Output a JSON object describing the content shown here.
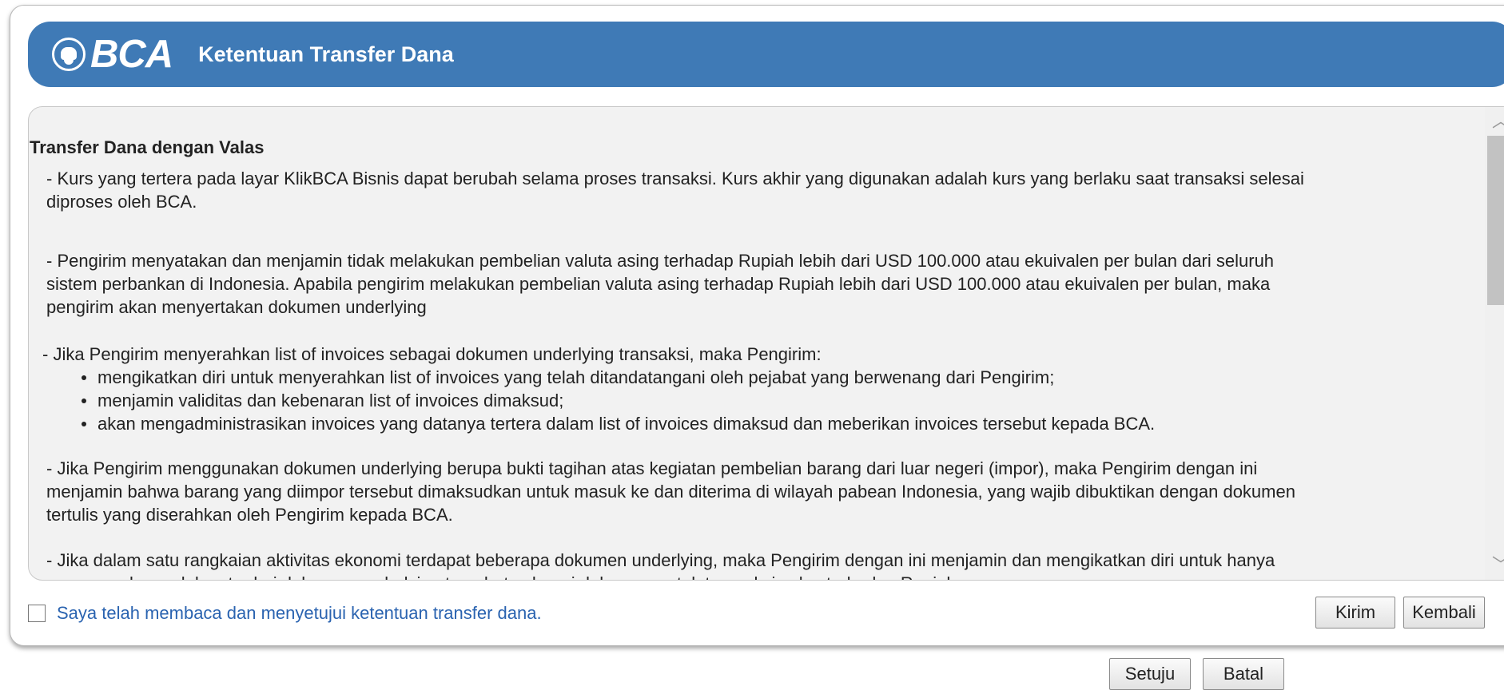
{
  "header": {
    "logo_text": "BCA",
    "title": "Ketentuan Transfer Dana"
  },
  "terms": {
    "title": "Transfer Dana dengan Valas",
    "para1": "- Kurs yang tertera pada layar KlikBCA Bisnis dapat berubah selama proses transaksi. Kurs akhir yang digunakan adalah kurs yang berlaku saat transaksi selesai\n  diproses oleh BCA.",
    "para2": "- Pengirim menyatakan dan menjamin tidak melakukan pembelian valuta asing terhadap Rupiah lebih dari USD 100.000 atau ekuivalen per bulan dari seluruh\n  sistem perbankan di Indonesia. Apabila pengirim melakukan pembelian valuta asing terhadap Rupiah lebih dari USD 100.000 atau ekuivalen per bulan, maka\n  pengirim akan menyertakan dokumen underlying",
    "para3_intro": "- Jika Pengirim menyerahkan list of invoices sebagai dokumen underlying transaksi, maka Pengirim:",
    "para3_bullets": [
      "mengikatkan diri untuk menyerahkan list of invoices yang telah ditandatangani oleh pejabat yang berwenang dari Pengirim;",
      "menjamin validitas dan kebenaran list of invoices dimaksud;",
      "akan mengadministrasikan invoices yang datanya tertera dalam list of invoices dimaksud dan meberikan invoices tersebut kepada BCA."
    ],
    "para4": "- Jika Pengirim menggunakan dokumen underlying berupa bukti tagihan atas kegiatan pembelian barang dari luar negeri (impor), maka Pengirim dengan ini\n  menjamin bahwa barang yang diimpor tersebut dimaksudkan untuk masuk ke dan diterima di wilayah pabean Indonesia, yang wajib dibuktikan dengan dokumen\n  tertulis yang diserahkan oleh Pengirim kepada BCA.",
    "para5": "- Jika dalam satu rangkaian aktivitas ekonomi terdapat beberapa dokumen underlying, maka Pengirim dengan ini menjamin dan mengikatkan diri untuk hanya\n  menggunakan salah satu dari dokumen underlying tersebut sebagai dokumen untuk transaksi valas terhadap Rupiah."
  },
  "scrollbar": {
    "up_glyph": "︿",
    "down_glyph": "﹀"
  },
  "agreement": {
    "label": "Saya telah membaca dan menyetujui ketentuan transfer dana.",
    "checked": false
  },
  "buttons": {
    "kirim": "Kirim",
    "kembali": "Kembali",
    "setuju": "Setuju",
    "batal": "Batal"
  },
  "colors": {
    "header_bg": "#3f7ab6",
    "link_text": "#2a63b0",
    "terms_bg": "#f2f2f2"
  }
}
